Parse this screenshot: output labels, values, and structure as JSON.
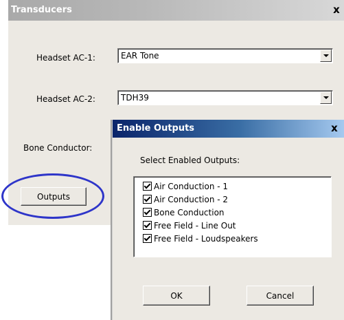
{
  "transducers": {
    "title": "Transducers",
    "close_glyph": "x",
    "headset_ac1": {
      "label": "Headset AC-1:",
      "value": "EAR Tone"
    },
    "headset_ac2": {
      "label": "Headset AC-2:",
      "value": "TDH39"
    },
    "bone_conductor": {
      "label": "Bone Conductor:"
    },
    "outputs_button": "Outputs"
  },
  "enable_outputs": {
    "title": "Enable Outputs",
    "close_glyph": "x",
    "prompt": "Select Enabled Outputs:",
    "options": [
      {
        "label": "Air Conduction - 1",
        "checked": true
      },
      {
        "label": "Air Conduction - 2",
        "checked": true
      },
      {
        "label": "Bone Conduction",
        "checked": true
      },
      {
        "label": "Free Field - Line Out",
        "checked": true
      },
      {
        "label": "Free Field - Loudspeakers",
        "checked": true
      }
    ],
    "ok_button": "OK",
    "cancel_button": "Cancel"
  },
  "colors": {
    "highlight_ellipse": "#2e35c9",
    "active_title": "#0a246a",
    "inactive_title": "#a9a9a9",
    "window_face": "#ece9e3"
  }
}
